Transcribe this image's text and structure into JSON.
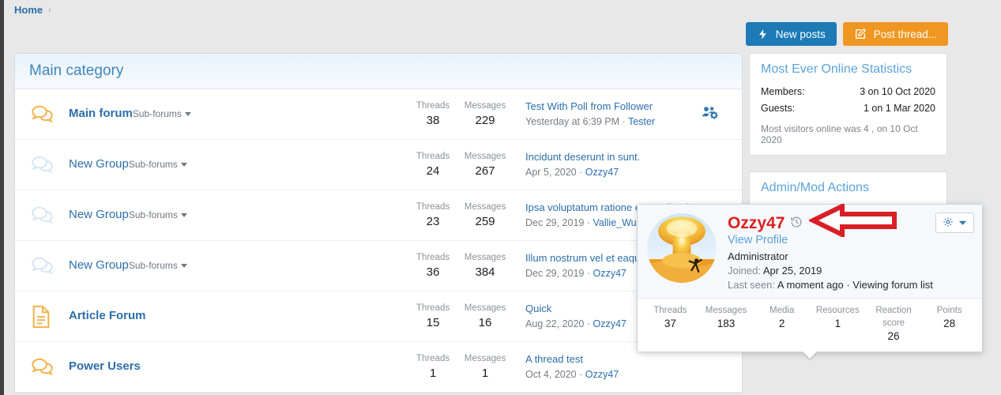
{
  "breadcrumb": {
    "home": "Home",
    "separator": "›"
  },
  "top_actions": {
    "new_posts": "New posts",
    "post_thread": "Post thread...",
    "new_posts_color": "#1d7ab5",
    "post_thread_color": "#f09721"
  },
  "category": {
    "title": "Main category"
  },
  "columns": {
    "threads": "Threads",
    "messages": "Messages"
  },
  "forums": [
    {
      "title": "Main forum",
      "unread": true,
      "icon": "chat-bubbles-icon-unread",
      "sub_forums_label": "Sub-forums",
      "threads_label": "Threads",
      "threads": "38",
      "messages_label": "Messages",
      "messages": "229",
      "last_title": "Test With Poll from Follower",
      "last_date": "Yesterday at 6:39 PM",
      "last_sep": "·",
      "last_user": "Tester",
      "extra_icon": "manage-members-gear-icon"
    },
    {
      "title": "New Group",
      "unread": false,
      "icon": "chat-bubbles-icon-read",
      "sub_forums_label": "Sub-forums",
      "threads_label": "Threads",
      "threads": "24",
      "messages_label": "Messages",
      "messages": "267",
      "last_title": "Incidunt deserunt in sunt.",
      "last_date": "Apr 5, 2020",
      "last_sep": "·",
      "last_user": "Ozzy47",
      "extra_icon": ""
    },
    {
      "title": "New Group",
      "unread": false,
      "icon": "chat-bubbles-icon-read",
      "sub_forums_label": "Sub-forums",
      "threads_label": "Threads",
      "threads": "23",
      "messages_label": "Messages",
      "messages": "259",
      "last_title": "Ipsa voluptatum ratione et repellendus incidunt",
      "last_date": "Dec 29, 2019",
      "last_sep": "·",
      "last_user": "Vallie_Wunsch",
      "extra_icon": ""
    },
    {
      "title": "New Group",
      "unread": false,
      "icon": "chat-bubbles-icon-read",
      "sub_forums_label": "Sub-forums",
      "threads_label": "Threads",
      "threads": "36",
      "messages_label": "Messages",
      "messages": "384",
      "last_title": "Illum nostrum vel et eaque ipsum",
      "last_date": "Dec 29, 2019",
      "last_sep": "·",
      "last_user": "Ozzy47",
      "extra_icon": ""
    },
    {
      "title": "Article Forum",
      "unread": true,
      "icon": "article-page-icon",
      "sub_forums_label": "",
      "threads_label": "Threads",
      "threads": "15",
      "messages_label": "Messages",
      "messages": "16",
      "last_title": "Quick",
      "last_date": "Aug 22, 2020",
      "last_sep": "·",
      "last_user": "Ozzy47",
      "extra_icon": ""
    },
    {
      "title": "Power Users",
      "unread": true,
      "icon": "chat-bubbles-icon-unread",
      "sub_forums_label": "",
      "threads_label": "Threads",
      "threads": "1",
      "messages_label": "Messages",
      "messages": "1",
      "last_title": "A thread test",
      "last_date": "Oct 4, 2020",
      "last_sep": "·",
      "last_user": "Ozzy47",
      "extra_icon": ""
    }
  ],
  "sidebar": {
    "stats": {
      "title": "Most Ever Online Statistics",
      "members_label": "Members:",
      "members_value": "3 on 10 Oct 2020",
      "guests_label": "Guests:",
      "guests_value": "1 on 1 Mar 2020",
      "note": "Most visitors online was 4 , on 10 Oct 2020"
    },
    "admin": {
      "title": "Admin/Mod Actions"
    },
    "member": {
      "name": "Ozzy47",
      "role": "Administrator",
      "avatar": "mushroom-cloud-avatar"
    }
  },
  "user_card": {
    "name": "Ozzy47",
    "name_color": "#e02020",
    "history_icon": "clock-history-icon",
    "view_profile": "View Profile",
    "role": "Administrator",
    "joined_label": "Joined:",
    "joined_value": "Apr 25, 2019",
    "last_seen_label": "Last seen:",
    "last_seen_value": "A moment ago · Viewing forum list",
    "gear_icon": "gear-icon",
    "gear_caret": "chevron-down-icon",
    "avatar": "mushroom-cloud-avatar",
    "stats": [
      {
        "label": "Threads",
        "value": "37"
      },
      {
        "label": "Messages",
        "value": "183"
      },
      {
        "label": "Media",
        "value": "2"
      },
      {
        "label": "Resources",
        "value": "1"
      },
      {
        "label": "Reaction score",
        "value": "26"
      },
      {
        "label": "Points",
        "value": "28"
      }
    ]
  },
  "annotation": {
    "arrow": "red-left-arrow-annotation",
    "color": "#d81f26"
  }
}
